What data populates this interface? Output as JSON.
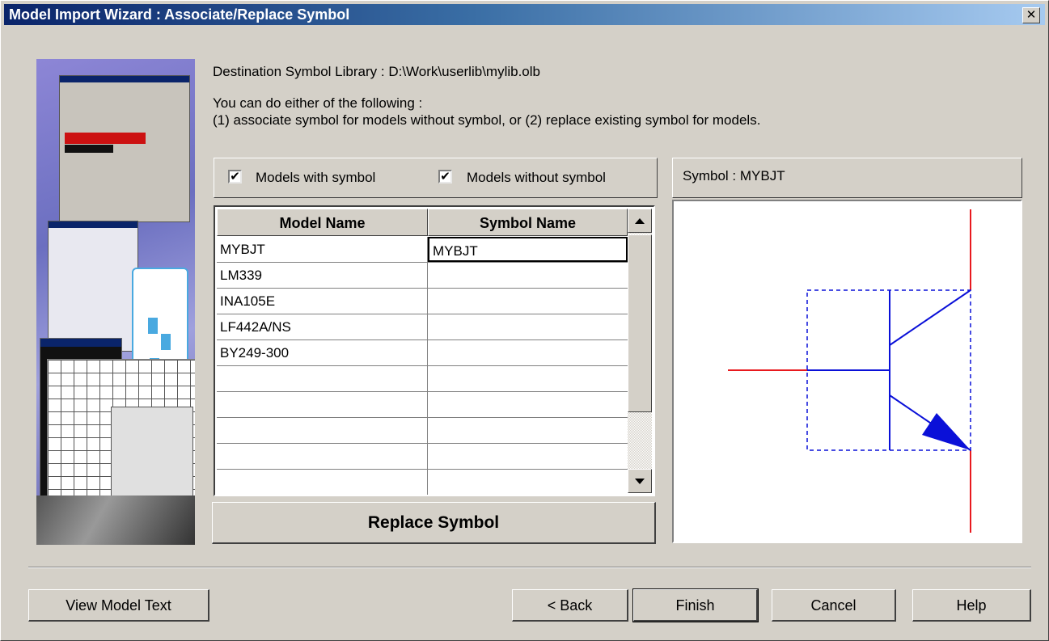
{
  "window": {
    "title": "Model Import Wizard : Associate/Replace Symbol",
    "close_label": "✕"
  },
  "info": {
    "destination_line": "Destination Symbol Library :  D:\\Work\\userlib\\mylib.olb",
    "instruction_line1": "You can do either of the following :",
    "instruction_line2": "(1) associate symbol for models without symbol, or (2) replace existing symbol for models."
  },
  "filters": {
    "with_symbol_label": "Models with symbol",
    "with_symbol_checked": true,
    "without_symbol_label": "Models without symbol",
    "without_symbol_checked": true,
    "check_glyph": "✔"
  },
  "table": {
    "columns": [
      "Model Name",
      "Symbol Name"
    ],
    "rows": [
      {
        "model": "MYBJT",
        "symbol": "MYBJT"
      },
      {
        "model": "LM339",
        "symbol": ""
      },
      {
        "model": "INA105E",
        "symbol": ""
      },
      {
        "model": "LF442A/NS",
        "symbol": ""
      },
      {
        "model": "BY249-300",
        "symbol": ""
      }
    ],
    "selected_row": 0
  },
  "replace_button_label": "Replace Symbol",
  "preview": {
    "label": "Symbol : MYBJT",
    "colors": {
      "pin": "#e8191e",
      "body": "#0a10d8"
    }
  },
  "buttons": {
    "view_model_text": "View Model Text",
    "back": "< Back",
    "finish": "Finish",
    "cancel": "Cancel",
    "help": "Help"
  },
  "icons": {
    "scroll_up": "up-arrow-icon",
    "scroll_down": "down-arrow-icon",
    "close": "close-icon"
  }
}
